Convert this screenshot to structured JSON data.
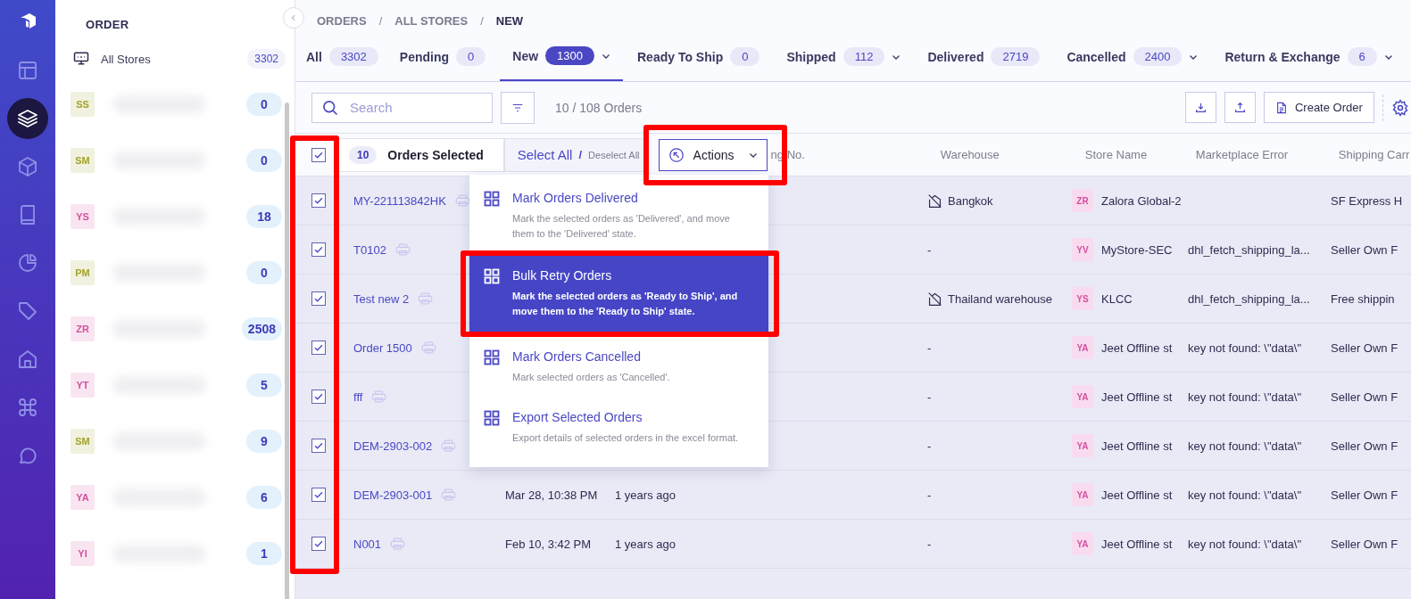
{
  "rail": {
    "items": [
      {
        "kind": "layout",
        "selected": false
      },
      {
        "kind": "layers",
        "selected": true
      },
      {
        "kind": "box",
        "selected": false
      },
      {
        "kind": "book",
        "selected": false
      },
      {
        "kind": "pie",
        "selected": false
      },
      {
        "kind": "tag",
        "selected": false
      },
      {
        "kind": "home",
        "selected": false
      },
      {
        "kind": "command",
        "selected": false
      },
      {
        "kind": "chat",
        "selected": false
      }
    ]
  },
  "sidebar": {
    "title": "ORDER",
    "all_stores": {
      "label": "All Stores",
      "count": "3302"
    },
    "stores": [
      {
        "initials": "SS",
        "color": "#a3a32b",
        "count": "0"
      },
      {
        "initials": "SM",
        "color": "#a3a32b",
        "count": "0"
      },
      {
        "initials": "YS",
        "color": "#d4509e",
        "count": "18"
      },
      {
        "initials": "PM",
        "color": "#a3a32b",
        "count": "0"
      },
      {
        "initials": "ZR",
        "color": "#d4509e",
        "count": "2508"
      },
      {
        "initials": "YT",
        "color": "#d4509e",
        "count": "5"
      },
      {
        "initials": "SM",
        "color": "#a3a32b",
        "count": "9"
      },
      {
        "initials": "YA",
        "color": "#d4509e",
        "count": "6"
      },
      {
        "initials": "YI",
        "color": "#d4509e",
        "count": "1"
      }
    ]
  },
  "breadcrumb": [
    {
      "kind": "link",
      "text": "ORDERS"
    },
    {
      "kind": "separator",
      "text": "/"
    },
    {
      "kind": "link",
      "text": "ALL STORES"
    },
    {
      "kind": "separator",
      "text": "/"
    },
    {
      "kind": "current",
      "text": "NEW"
    }
  ],
  "tabs": [
    {
      "label": "All",
      "count": "3302",
      "selected": false,
      "has_menu": false
    },
    {
      "label": "Pending",
      "count": "0",
      "selected": false,
      "has_menu": false
    },
    {
      "label": "New",
      "count": "1300",
      "selected": true,
      "has_menu": true
    },
    {
      "label": "Ready To Ship",
      "count": "0",
      "selected": false,
      "has_menu": false
    },
    {
      "label": "Shipped",
      "count": "112",
      "selected": false,
      "has_menu": true
    },
    {
      "label": "Delivered",
      "count": "2719",
      "selected": false,
      "has_menu": false
    },
    {
      "label": "Cancelled",
      "count": "2400",
      "selected": false,
      "has_menu": true
    },
    {
      "label": "Return & Exchange",
      "count": "6",
      "selected": false,
      "has_menu": true
    }
  ],
  "toolbar": {
    "search_placeholder": "Search",
    "order_count": "10 / 108 Orders",
    "create_button": "Create Order"
  },
  "selection_bar": {
    "checked": true,
    "count": "10",
    "label": "Orders Selected",
    "select_all": "Select All",
    "separator": "/",
    "deselect_all": "Deselect All",
    "actions": "Actions"
  },
  "table": {
    "columns": [
      "ng No.",
      "Warehouse",
      "Store Name",
      "Marketplace Error",
      "Shipping Carr"
    ],
    "rows": [
      {
        "checked": true,
        "order_no": "MY-221113842HK",
        "warehouse": "Bangkok",
        "warehouse_icon": true,
        "store_initials": "ZR",
        "store_name": "Zalora Global-2",
        "carrier": "SF Express H"
      },
      {
        "checked": true,
        "order_no": "T0102",
        "warehouse": "-",
        "warehouse_icon": false,
        "store_initials": "YV",
        "store_name": "MyStore-SEC",
        "error": "dhl_fetch_shipping_la...",
        "carrier": "Seller Own F"
      },
      {
        "checked": true,
        "order_no": "Test new 2",
        "warehouse": "Thailand warehouse",
        "warehouse_icon": true,
        "store_initials": "YS",
        "store_name": "KLCC",
        "error": "dhl_fetch_shipping_la...",
        "carrier": "Free shippin"
      },
      {
        "checked": true,
        "order_no": "Order 1500",
        "warehouse": "-",
        "warehouse_icon": false,
        "store_initials": "YA",
        "store_name": "Jeet Offline st",
        "error": "key not found: \\\"data\\\"",
        "carrier": "Seller Own F"
      },
      {
        "checked": true,
        "order_no": "fff",
        "warehouse": "-",
        "warehouse_icon": false,
        "store_initials": "YA",
        "store_name": "Jeet Offline st",
        "error": "key not found: \\\"data\\\"",
        "carrier": "Seller Own F"
      },
      {
        "checked": true,
        "order_no": "DEM-2903-002",
        "warehouse": "-",
        "warehouse_icon": false,
        "store_initials": "YA",
        "store_name": "Jeet Offline st",
        "error": "key not found: \\\"data\\\"",
        "carrier": "Seller Own F"
      },
      {
        "checked": true,
        "order_no": "DEM-2903-001",
        "date": "Mar 28, 10:38 PM",
        "age": "1 years ago",
        "warehouse": "-",
        "warehouse_icon": false,
        "store_initials": "YA",
        "store_name": "Jeet Offline st",
        "error": "key not found: \\\"data\\\"",
        "carrier": "Seller Own F"
      },
      {
        "checked": true,
        "order_no": "N001",
        "date": "Feb 10, 3:42 PM",
        "age": "1 years ago",
        "warehouse": "-",
        "warehouse_icon": false,
        "store_initials": "YA",
        "store_name": "Jeet Offline st",
        "error": "key not found: \\\"data\\\"",
        "carrier": "Seller Own F"
      }
    ]
  },
  "actions_menu": [
    {
      "title": "Mark Orders Delivered",
      "description": "Mark the selected orders as 'Delivered', and move them to the 'Delivered' state.",
      "selected": false
    },
    {
      "title": "Bulk Retry Orders",
      "description": "Mark the selected orders as 'Ready to Ship', and move them to the 'Ready to Ship' state.",
      "selected": true
    },
    {
      "title": "Mark Orders Cancelled",
      "description": "Mark selected orders as 'Cancelled'.",
      "selected": false
    },
    {
      "title": "Export Selected Orders",
      "description": "Export details of selected orders in the excel format.",
      "selected": false
    }
  ]
}
